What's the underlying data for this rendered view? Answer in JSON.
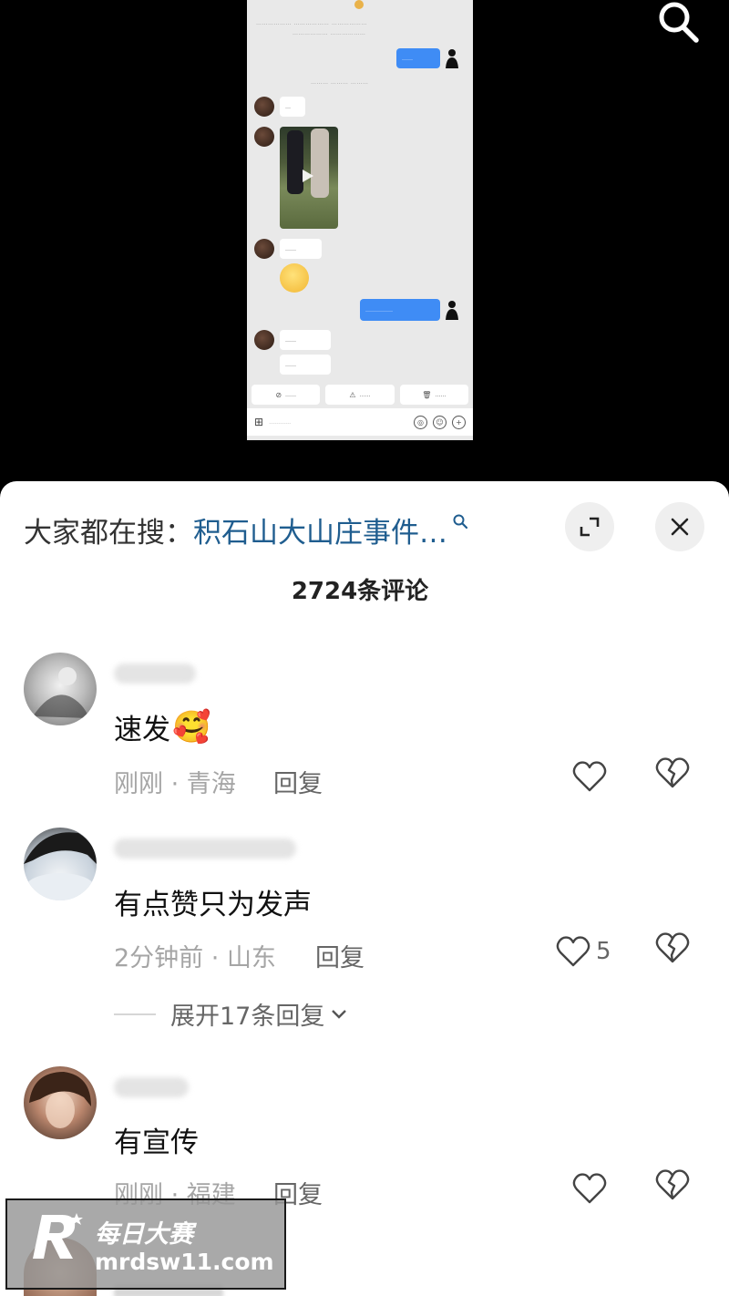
{
  "video": {
    "phone_screen": {
      "header_line1": "……………… ……………… ………………",
      "header_line2": "……………… ………………",
      "sent_top": "……",
      "system_line": "……… ……… ………",
      "msg_1": "…",
      "msg_2": "……",
      "msg_3": "……",
      "msg_4": "……",
      "sent_mid": "……………",
      "actions": [
        "……",
        "……",
        "……"
      ],
      "input_placeholder": "…………"
    },
    "search_icon": "search-icon"
  },
  "panel": {
    "search_prefix": "大家都在搜：",
    "search_term": "积石山大山庄事件…",
    "comment_count": "2724条评论",
    "comments": [
      {
        "text": "速发",
        "emoji": "🥰",
        "time": "刚刚",
        "location": "青海",
        "reply": "回复",
        "likes": ""
      },
      {
        "text": "有点赞只为发声",
        "time": "2分钟前",
        "location": "山东",
        "reply": "回复",
        "likes": "5"
      },
      {
        "text": "有宣传",
        "time": "刚刚",
        "location": "福建",
        "reply": "回复",
        "likes": ""
      }
    ],
    "expand_replies": "展开17条回复"
  },
  "watermark": {
    "title": "每日大赛",
    "url": "mrdsw11.com"
  }
}
